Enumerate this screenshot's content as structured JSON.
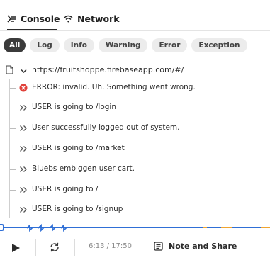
{
  "tabs": [
    {
      "label": "Console",
      "icon": "console-icon",
      "active": true
    },
    {
      "label": "Network",
      "icon": "wifi-icon",
      "active": false
    }
  ],
  "filters": [
    "All",
    "Log",
    "Info",
    "Warning",
    "Error",
    "Exception"
  ],
  "active_filter": "All",
  "page": {
    "url": "https://fruitshoppe.firebaseapp.com/#/",
    "icon": "document-icon",
    "expanded": true
  },
  "logs": [
    {
      "type": "error",
      "icon": "error-circle-icon",
      "text": "ERROR: invalid. Uh. Something went wrong."
    },
    {
      "type": "log",
      "icon": "double-chevron-icon",
      "text": "USER is going to /login"
    },
    {
      "type": "log",
      "icon": "double-chevron-icon",
      "text": "User successfully logged out of system."
    },
    {
      "type": "log",
      "icon": "double-chevron-icon",
      "text": "USER is going to /market"
    },
    {
      "type": "log",
      "icon": "double-chevron-icon",
      "text": "Bluebs embiggen user cart."
    },
    {
      "type": "log",
      "icon": "double-chevron-icon",
      "text": "USER is going to /"
    },
    {
      "type": "log",
      "icon": "double-chevron-icon",
      "text": "USER is going to /signup"
    }
  ],
  "player": {
    "time": "6:13 / 17:50",
    "note_label": "Note and Share"
  },
  "colors": {
    "timeline": "#2f6fd6",
    "event_marker": "#f0a530",
    "error": "#e0413a"
  }
}
